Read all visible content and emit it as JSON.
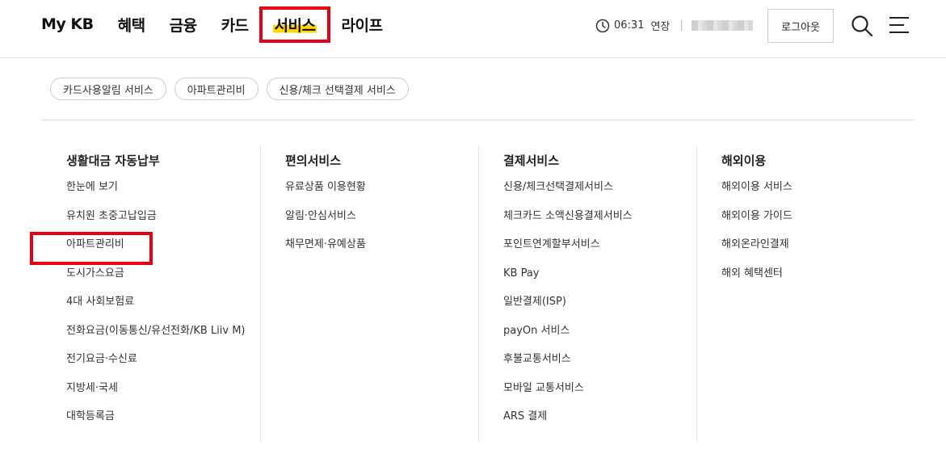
{
  "gnb": {
    "items": [
      {
        "label": "My KB"
      },
      {
        "label": "혜택"
      },
      {
        "label": "금융"
      },
      {
        "label": "카드"
      },
      {
        "label": "서비스",
        "active": true
      },
      {
        "label": "라이프"
      }
    ]
  },
  "session": {
    "time": "06:31",
    "extend_label": "연장",
    "separator": "|",
    "clock_icon": "clock-icon"
  },
  "header_actions": {
    "logout_label": "로그아웃",
    "search_icon": "search-icon",
    "menu_icon": "hamburger-menu-icon"
  },
  "quick_links": [
    {
      "label": "카드사용알림 서비스"
    },
    {
      "label": "아파트관리비"
    },
    {
      "label": "신용/체크 선택결제 서비스"
    }
  ],
  "columns": [
    {
      "title": "생활대금 자동납부",
      "items": [
        {
          "label": "한눈에 보기"
        },
        {
          "label": "유치원 초중고납입금"
        },
        {
          "label": "아파트관리비"
        },
        {
          "label": "도시가스요금"
        },
        {
          "label": "4대 사회보험료"
        },
        {
          "label": "전화요금(이동통신/유선전화/KB Liiv M)"
        },
        {
          "label": "전기요금·수신료"
        },
        {
          "label": "지방세·국세"
        },
        {
          "label": "대학등록금"
        }
      ]
    },
    {
      "title": "편의서비스",
      "items": [
        {
          "label": "유료상품 이용현황"
        },
        {
          "label": "알림·안심서비스"
        },
        {
          "label": "채무면제·유예상품"
        }
      ]
    },
    {
      "title": "결제서비스",
      "items": [
        {
          "label": "신용/체크선택결제서비스"
        },
        {
          "label": "체크카드 소액신용결제서비스"
        },
        {
          "label": "포인트연계할부서비스"
        },
        {
          "label": "KB Pay"
        },
        {
          "label": "일반결제(ISP)"
        },
        {
          "label": "payOn 서비스"
        },
        {
          "label": "후불교통서비스"
        },
        {
          "label": "모바일 교통서비스"
        },
        {
          "label": "ARS 결제"
        }
      ]
    },
    {
      "title": "해외이용",
      "items": [
        {
          "label": "해외이용 서비스"
        },
        {
          "label": "해외이용 가이드"
        },
        {
          "label": "해외온라인결제"
        },
        {
          "label": "해외 혜택센터"
        }
      ]
    }
  ],
  "colors": {
    "highlight": "#ffd400",
    "annotation_red": "#e60012"
  }
}
